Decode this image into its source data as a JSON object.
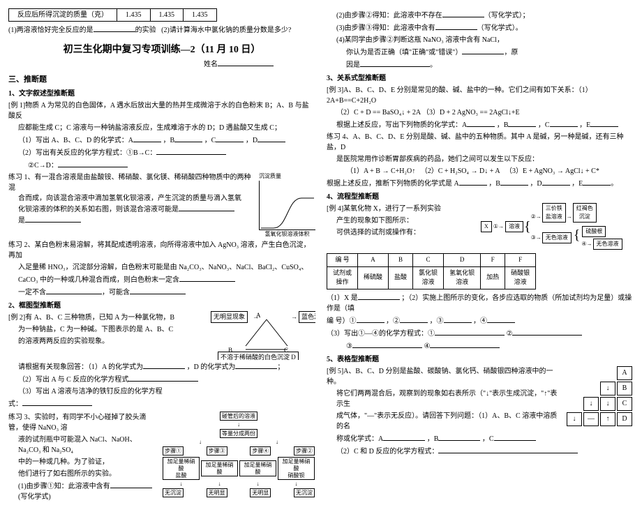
{
  "top_table": {
    "row_label": "反应后所得沉淀的质量（克）",
    "cells": [
      "1.435",
      "1.435",
      "1.435"
    ]
  },
  "top_q": {
    "q1_pre": "(1)两溶液恰好完全反应的是",
    "q1_post": "的实验",
    "q2": "(2)请计算海水中氯化钠的质量分数是多少?"
  },
  "title": "初三生化期中复习专项训练—2（11 月 10 日）",
  "name_label": "姓名",
  "section3": "三、推断题",
  "type1": {
    "heading": "1、文字叙述型推断题",
    "ex1": {
      "label": "[例 1]",
      "text1": "物质 A 为常见的白色固体，A 遇水后放出大量的热并生成微溶于水的白色粉末 B；A、B 与盐酸反",
      "text2": "应都能生成 C；C 溶液与一种钠盐溶液反应，生成难溶于水的 D；D 遇盐酸又生成 C；",
      "q1a": "（1）写出 A、B、C、D 的化学式：A",
      "q1b": "，B",
      "q1c": "，C",
      "q1d": "，D",
      "q2": "（2）写出有关反应的化学方程式：①B→C：",
      "q2b": "②C→D："
    },
    "p1": {
      "label": "练习 1、",
      "text1": "有一混合溶液是由盐酸铵、稀硝酸、氯化镁、稀硝酸四种物质中的两种混",
      "text2": "合而成，向该混合溶液中滴加氢氧化钡溶液，产生沉淀的质量与滴入氢氧",
      "text3": "化钡溶液的体积的关系如右图，则该混合溶液可能是",
      "text4": "是",
      "axis_y": "沉淀质量",
      "axis_x": "氢氧化钡溶液体积"
    },
    "p2": {
      "label": "练习 2、",
      "text1": "某白色粉末易溶解，将其配成透明溶液，向所得溶液中加入 AgNO₃ 溶液，产生白色沉淀，再加",
      "text2": "入足量稀 HNO₃，沉淀部分溶解，白色粉末可能是由 Na₂CO₃、NaNO₃、NaCl、BaCl₂、CuSO₄、",
      "text3": "CaCO₃ 中的一种或几种混合而成，则白色粉末一定含",
      "text4": "一定不含"
    }
  },
  "type2": {
    "heading": "2、框图型推断题",
    "ex2": {
      "label": "[例 2]",
      "text1": "有 A、B、C 三种物质，已知 A 为一种氯化物，B",
      "text2": "为一种钠盐，C 为一种碱。下图表示的是 A、B、C",
      "text3": "的溶液两两反应的实验现象。",
      "tri_top": "无明显现象",
      "tri_right": "蓝色沉淀",
      "tri_bottom": "不溶于稀硝酸的白色沉淀 D",
      "A": "A",
      "B": "B",
      "C": "C",
      "q": "请根据有关现象回答：（1）A 的化学式为",
      "qd": "，D 的化学式为",
      "q2": "（2）写出 A 与 C 反应的化学方程式",
      "q3": "（3）写出 A 溶液与洁净的铁钉反应的化学方程",
      "q3b": "式："
    },
    "p3": {
      "label": "练习 3、",
      "text1": "实验时，有同学不小心碰掉了胶头滴管，使得 NaNO₃ 溶",
      "text2": "液的试剂瓶中可能混入 NaCl、NaOH、Na₂CO₃ 和 Na₂SO₄",
      "text3": "中的一种或几种。为了验证，",
      "text4": "他们进行了如右图所示的实验。",
      "s1": "(1)由步骤①知：此溶液中含有",
      "s1b": "(写化学式)"
    },
    "flow": {
      "start": "碰管后的溶液",
      "step": "等量分成两份",
      "l1": "步骤①",
      "l2": "步骤②",
      "add1": "加足量稀硝酸",
      "add1b": "盐酸",
      "add2": "加足量稀硝酸",
      "add2b": "硝酸钡",
      "r1": "无沉淀",
      "r2": "无沉淀",
      "down1": "无明显",
      "down2": "无明显",
      "mid1": "步骤③",
      "mid1b": "加足量稀硝酸",
      "mid2": "步骤④",
      "mid2b": "加足量稀硝酸"
    }
  },
  "right": {
    "s2": "(2)由步骤②得知：此溶液中不存在",
    "s2b": "（写化学式）；",
    "s3": "(3)由步骤③得知：此溶液中含有",
    "s3b": "（写化学式）。",
    "s4a": "(4)某同学由步骤②判断这瓶 NaNO₃ 溶液中含有 NaCl，",
    "s4b": "你认为是否正确（填\"正确\"或\"错误\"）",
    "s4c": "，原",
    "s4d": "因是",
    "type3": "3、关系式型推断题",
    "ex3": {
      "label": "[例 3]",
      "t1": "A、B、C、D、E 分别是常见的酸、碱、盐中的一种。它们之间有如下关系：（1）2A+B==C+2H₂O",
      "t2": "（2）C + D == BaSO₄↓ + 2A     （3）D + 2 AgNO₃ == 2AgCl↓+E",
      "t3": "根据上述反应，写出下列物质的化学式：A",
      "t3b": "，B",
      "t3c": "，C",
      "t3d": "，E"
    },
    "p4": {
      "label": "练习 4、",
      "t1": "A、B、C、D、E 分别是酸、碱、盐中的五种物质。其中 A 是碱，另一种是碱，还有三种盐，D",
      "t2": "是医院常用作诊断胃部疾病的药品，她们之间可以发生以下反应：",
      "r1a": "（1）A + B → C+H₂O↑",
      "r1b": "（2）C + H₂SO₄ → D↓ + A",
      "r1c": "（3）E + AgNO₃ → AgCl↓ + C*",
      "t3": "根据上述反应，推断下列物质的化学式是 A",
      "t3b": "，B",
      "t3c": "，D",
      "t3d": "，E"
    },
    "type4": "4、流程型推断题",
    "ex4": {
      "label": "[例 4]",
      "t1": "某氧化物 X，进行了一系列实验",
      "t2": "产生的现象如下图所示：",
      "t3": "可供选择的试剂或操作有："
    },
    "rflow": {
      "x": "X",
      "sol": "溶液",
      "arrow": "→",
      "b1": "三价铁",
      "b1s": "盐溶液",
      "b2": "红褐色",
      "b2s": "沉淀",
      "b3": "无色溶液",
      "b4": "硫酸根",
      "b5": "无色溶液"
    },
    "trial": {
      "h_num": "编 号",
      "A": "A",
      "B": "B",
      "C": "C",
      "D": "D",
      "E": "F",
      "F": "F",
      "h_op": "试剂或",
      "h_op2": "操作",
      "c1": "稀硫酸",
      "c2": "盐酸",
      "c3": "氯化钡",
      "c3b": "溶液",
      "c4": "氢氧化钡",
      "c4b": "溶液",
      "c5": "加热",
      "c6": "硝酸银",
      "c6b": "溶液"
    },
    "ex4q": {
      "q1a": "（1）X 是",
      "q1b": "；（2）实施上图所示的变化，各步应选取的物质（所加试剂均为足量）或操作是（填",
      "q2a": "编 号）①",
      "q2b": "，②",
      "q2c": "，③",
      "q2d": "，④",
      "q3": "（3）写出①—④的化学方程式：①",
      "q3b": "②",
      "q3c": "③",
      "q3d": "④"
    },
    "type5": "5、表格型推断题",
    "ex5": {
      "label": "[例 5]",
      "t1": "A、B、C、D 分别是盐酸、碳酸钠、氯化钙、硝酸银四种溶液中的一种。",
      "t2": "将它们两两混合后，观察到的现象如右表所示（\"↓\"表示生成沉淀，\"↑\"表示生",
      "t3": "成气体，\"—\"表示无反应）。请回答下列问题：（1）A、B、C 溶液中溶质的名",
      "t4": "称或化学式：A",
      "t4b": "，B",
      "t4c": "，C",
      "t5": "（2）C 和 D 反应的化学方程式：",
      "grid": {
        "A": "A",
        "B": "B",
        "C": "C",
        "D": "D",
        "down": "↓",
        "up": "↑",
        "dash": "—"
      }
    }
  }
}
